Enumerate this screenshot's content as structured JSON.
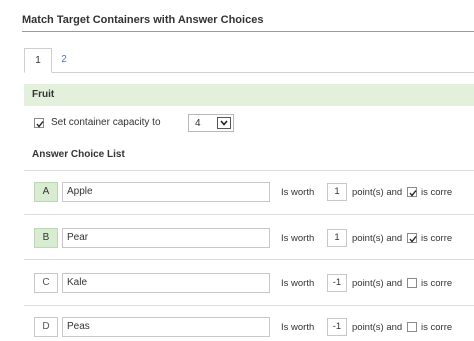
{
  "header": {
    "title": "Match Target Containers with Answer Choices"
  },
  "tabs": [
    {
      "label": "1"
    },
    {
      "label": "2"
    }
  ],
  "category": {
    "label": "Fruit"
  },
  "capacity": {
    "label": "Set container capacity to",
    "value": "4",
    "checked": true
  },
  "answer_list": {
    "title": "Answer Choice List",
    "worth_label": "Is worth",
    "points_label": "point(s) and",
    "correct_label": "is corre",
    "rows": [
      {
        "letter": "A",
        "text": "Apple",
        "points": "1",
        "correct": true
      },
      {
        "letter": "B",
        "text": "Pear",
        "points": "1",
        "correct": true
      },
      {
        "letter": "C",
        "text": "Kale",
        "points": "-1",
        "correct": false
      },
      {
        "letter": "D",
        "text": "Peas",
        "points": "-1",
        "correct": false
      }
    ]
  },
  "colors": {
    "accent_green": "#e3f0dc",
    "tab_link": "#3b7dd8"
  }
}
